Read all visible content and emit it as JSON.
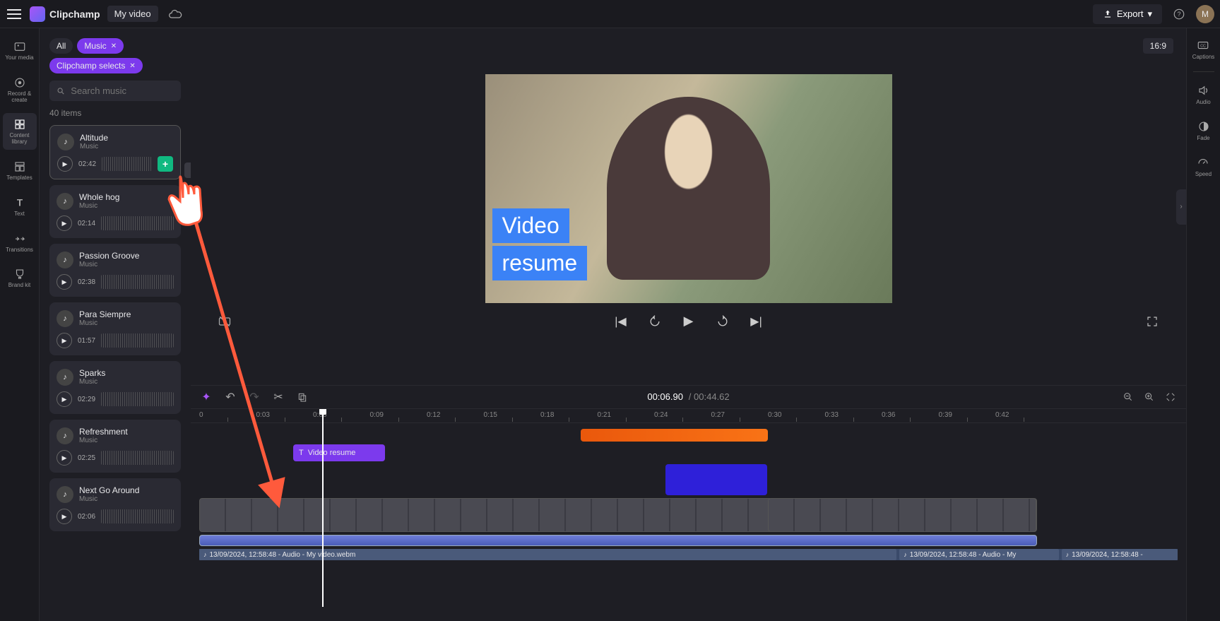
{
  "topbar": {
    "brand": "Clipchamp",
    "project": "My video",
    "export": "Export",
    "avatar_initial": "M"
  },
  "left_rail": [
    {
      "id": "your-media",
      "label": "Your media"
    },
    {
      "id": "record-create",
      "label": "Record & create"
    },
    {
      "id": "content-library",
      "label": "Content library"
    },
    {
      "id": "templates",
      "label": "Templates"
    },
    {
      "id": "text",
      "label": "Text"
    },
    {
      "id": "transitions",
      "label": "Transitions"
    },
    {
      "id": "brand-kit",
      "label": "Brand kit"
    }
  ],
  "side_panel": {
    "chip_all": "All",
    "chip_music": "Music",
    "chip_selects": "Clipchamp selects",
    "search_placeholder": "Search music",
    "item_count": "40 items",
    "tooltip": "Add to timeline",
    "tracks": [
      {
        "title": "Altitude",
        "sub": "Music",
        "dur": "02:42"
      },
      {
        "title": "Whole hog",
        "sub": "Music",
        "dur": "02:14"
      },
      {
        "title": "Passion Groove",
        "sub": "Music",
        "dur": "02:38"
      },
      {
        "title": "Para Siempre",
        "sub": "Music",
        "dur": "01:57"
      },
      {
        "title": "Sparks",
        "sub": "Music",
        "dur": "02:29"
      },
      {
        "title": "Refreshment",
        "sub": "Music",
        "dur": "02:25"
      },
      {
        "title": "Next Go Around",
        "sub": "Music",
        "dur": "02:06"
      }
    ]
  },
  "preview": {
    "aspect": "16:9",
    "title_line1": "Video",
    "title_line2": "resume"
  },
  "time": {
    "current": "00:06.90",
    "sep": "/",
    "total": "00:44.62"
  },
  "ruler": [
    "0",
    "0:03",
    "0:06",
    "0:09",
    "0:12",
    "0:15",
    "0:18",
    "0:21",
    "0:24",
    "0:27",
    "0:30",
    "0:33",
    "0:36",
    "0:39",
    "0:42"
  ],
  "timeline": {
    "text_clip": "Video resume",
    "audio1": "13/09/2024, 12:58:48 - Audio - My video.webm",
    "audio2": "13/09/2024, 12:58:48 - Audio - My",
    "audio3": "13/09/2024, 12:58:48 -"
  },
  "right_rail": [
    {
      "id": "captions",
      "label": "Captions"
    },
    {
      "id": "audio",
      "label": "Audio"
    },
    {
      "id": "fade",
      "label": "Fade"
    },
    {
      "id": "speed",
      "label": "Speed"
    }
  ]
}
